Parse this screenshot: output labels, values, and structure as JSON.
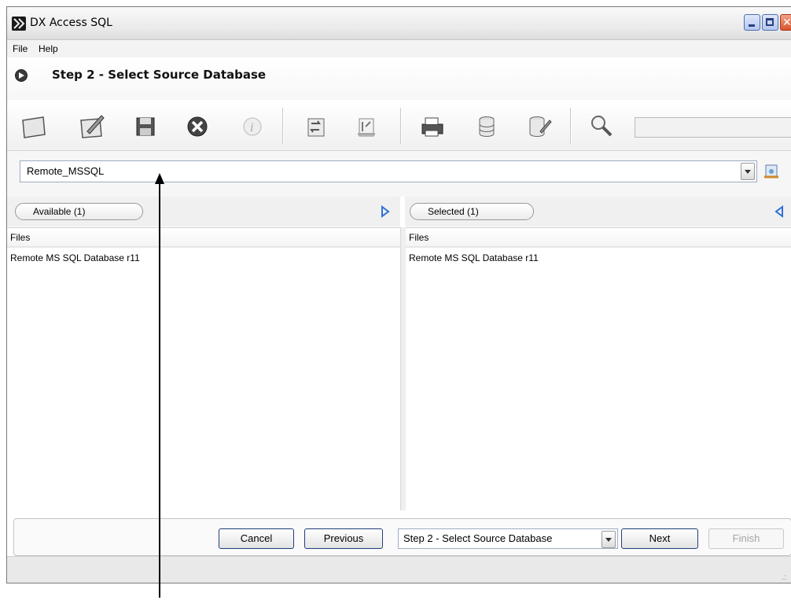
{
  "window": {
    "title": "DX Access SQL"
  },
  "menu": {
    "file": "File",
    "help": "Help"
  },
  "step_header": {
    "title": "Step 2 - Select Source Database"
  },
  "toolbar": {
    "buttons": [
      "new-icon",
      "edit-icon",
      "save-icon",
      "delete-icon",
      "info-icon",
      "refresh-icon",
      "import-icon",
      "print-icon",
      "database-icon",
      "database-edit-icon",
      "search-icon"
    ]
  },
  "source": {
    "selected": "Remote_MSSQL"
  },
  "available": {
    "label": "Available (1)",
    "column": "Files",
    "rows": [
      "Remote MS SQL Database r11"
    ]
  },
  "selected": {
    "label": "Selected (1)",
    "column": "Files",
    "rows": [
      "Remote MS SQL Database r11"
    ]
  },
  "buttons": {
    "cancel": "Cancel",
    "previous": "Previous",
    "step_select": "Step 2 - Select Source Database",
    "next": "Next",
    "finish": "Finish"
  },
  "colors": {
    "accent": "#1f3e7a",
    "close": "#d9532e",
    "arrow_blue": "#2f6fd6"
  }
}
